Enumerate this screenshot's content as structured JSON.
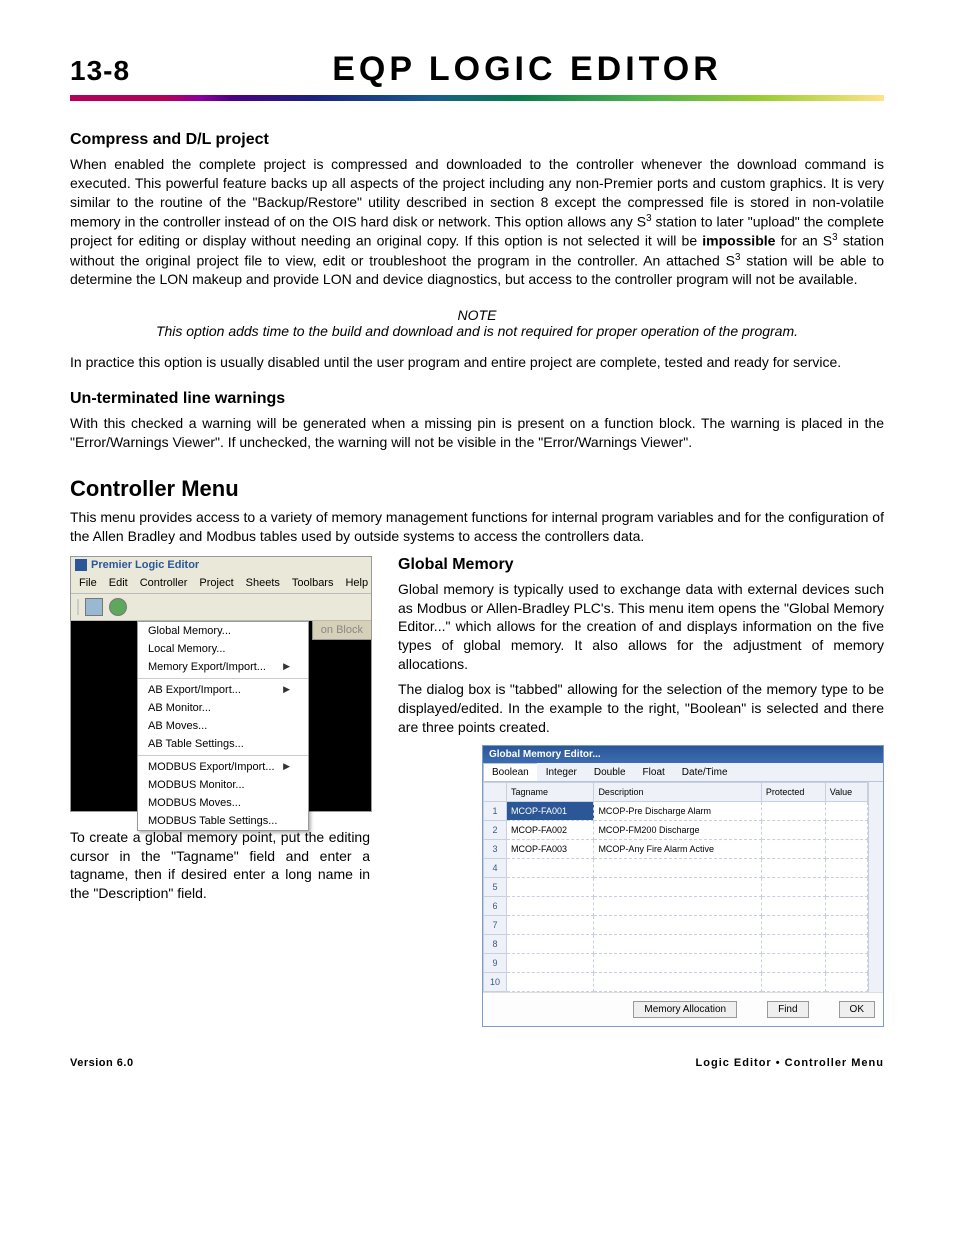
{
  "header": {
    "page_num": "13-8",
    "title": "EQP Logic Editor"
  },
  "sections": {
    "compress": {
      "title": "Compress and D/L project",
      "p1a": "When enabled the complete project is compressed and downloaded to the controller whenever the download command is executed.  This powerful feature backs up all aspects of the project including any non-Premier ports and custom graphics.  It is very similar to the routine of the \"Backup/Restore\" utility described in section 8 except the compressed file is stored in non-volatile memory in the controller instead of on the OIS hard disk or network.  This option allows any S",
      "p1b": " station to later \"upload\" the complete project for editing or display without needing an original copy.  If this option is not selected it will be ",
      "p1_bold": "impossible",
      "p1c": " for an S",
      "p1d": " station without the original project file to view, edit or troubleshoot the program in the controller.  An attached S",
      "p1e": " station will be able to determine the LON makeup and provide LON and device diagnostics, but access to the controller program will not be available.",
      "note_title": "NOTE",
      "note_body": "This option adds time to the build and download and is not required for proper operation of the program.",
      "p2": "In practice this option is usually disabled until the user program and entire project are complete, tested and ready for service."
    },
    "unterm": {
      "title": "Un-terminated line warnings",
      "p1": "With this checked a warning will be generated when a missing pin is present on a function block.  The warning is placed in the \"Error/Warnings Viewer\".  If unchecked, the warning will not be visible in the \"Error/Warnings Viewer\"."
    },
    "controller": {
      "title": "Controller Menu",
      "p1": "This menu provides access to a variety of memory management functions for internal program variables and for the configuration of the Allen Bradley and Modbus tables used by outside systems to access the controllers data."
    },
    "globalmem": {
      "title": "Global Memory",
      "p1": "Global memory is typically used to exchange data with external devices such as Modbus or Allen-Bradley PLC's.  This menu item opens the \"Global Memory Editor...\" which allows for the creation of and displays information on the five types of global memory.  It also allows for the adjustment of memory allocations.",
      "p2": "The dialog box is \"tabbed\" allowing for the selection of the memory type to be displayed/edited.  In the example to the right, \"Boolean\" is selected and there are three points created.",
      "p3": "To create a global memory point, put the editing cursor in the \"Tagname\" field and enter a tagname, then if desired enter a long name in the \"Description\" field."
    }
  },
  "ple": {
    "title": "Premier Logic Editor",
    "menus": [
      "File",
      "Edit",
      "Controller",
      "Project",
      "Sheets",
      "Toolbars",
      "Help"
    ],
    "btn_block": "on Block",
    "dropdown": {
      "g1": [
        "Global Memory...",
        "Local Memory...",
        "Memory Export/Import..."
      ],
      "g2": [
        "AB Export/Import...",
        "AB Monitor...",
        "AB Moves...",
        "AB Table Settings..."
      ],
      "g3": [
        "MODBUS Export/Import...",
        "MODBUS Monitor...",
        "MODBUS Moves...",
        "MODBUS Table Settings..."
      ]
    }
  },
  "gme": {
    "title": "Global Memory Editor...",
    "tabs": [
      "Boolean",
      "Integer",
      "Double",
      "Float",
      "Date/Time"
    ],
    "cols": [
      "Tagname",
      "Description",
      "Protected",
      "Value"
    ],
    "rows": [
      {
        "n": "1",
        "tag": "MCOP-FA001",
        "desc": "MCOP-Pre Discharge Alarm"
      },
      {
        "n": "2",
        "tag": "MCOP-FA002",
        "desc": "MCOP-FM200 Discharge"
      },
      {
        "n": "3",
        "tag": "MCOP-FA003",
        "desc": "MCOP-Any Fire Alarm Active"
      },
      {
        "n": "4",
        "tag": "",
        "desc": ""
      },
      {
        "n": "5",
        "tag": "",
        "desc": ""
      },
      {
        "n": "6",
        "tag": "",
        "desc": ""
      },
      {
        "n": "7",
        "tag": "",
        "desc": ""
      },
      {
        "n": "8",
        "tag": "",
        "desc": ""
      },
      {
        "n": "9",
        "tag": "",
        "desc": ""
      },
      {
        "n": "10",
        "tag": "",
        "desc": ""
      }
    ],
    "buttons": {
      "mem": "Memory Allocation",
      "find": "Find",
      "ok": "OK"
    }
  },
  "footer": {
    "version": "Version 6.0",
    "path": "Logic Editor • Controller Menu"
  }
}
